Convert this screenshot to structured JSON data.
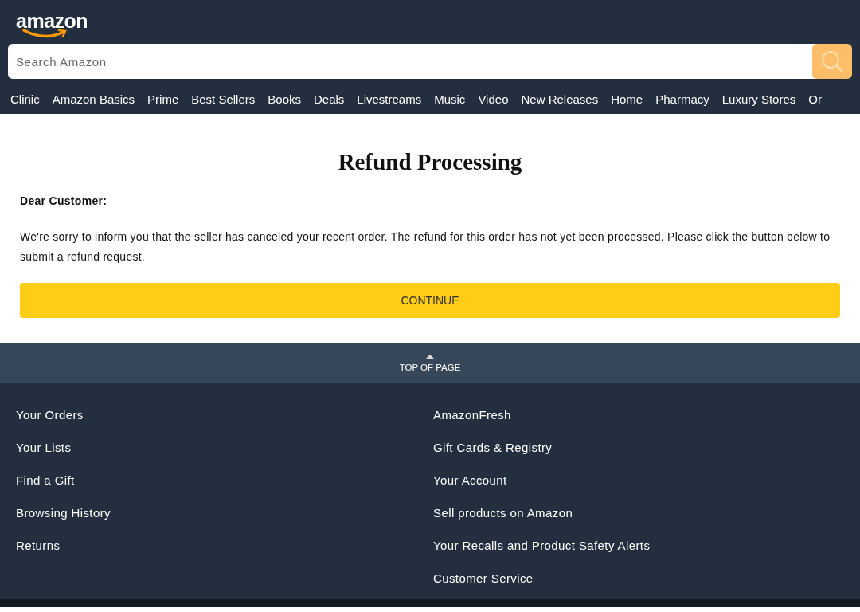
{
  "header": {
    "logo": "amazon",
    "search": {
      "placeholder": "Search Amazon"
    },
    "nav": [
      "Clinic",
      "Amazon Basics",
      "Prime",
      "Best Sellers",
      "Books",
      "Deals",
      "Livestreams",
      "Music",
      "Video",
      "New Releases",
      "Home",
      "Pharmacy",
      "Luxury Stores",
      "Or"
    ]
  },
  "main": {
    "title": "Refund Processing",
    "greeting": "Dear Customer:",
    "message": "We're sorry to inform you that the seller has canceled your recent order. The refund for this order has not yet been processed. Please click the button below to submit a refund request.",
    "button": "CONTINUE"
  },
  "back_to_top": "TOP OF PAGE",
  "footer": {
    "columns": [
      [
        "Your Orders",
        "Your Lists",
        "Find a Gift",
        "Browsing History",
        "Returns"
      ],
      [
        "AmazonFresh",
        "Gift Cards & Registry",
        "Your Account",
        "Sell products on Amazon",
        "Your Recalls and Product Safety Alerts",
        "Customer Service"
      ]
    ]
  }
}
